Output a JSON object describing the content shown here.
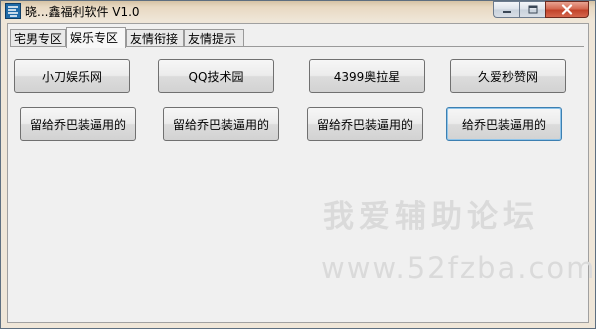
{
  "window": {
    "title": "晓...鑫福利软件  V1.0"
  },
  "tabs": [
    {
      "label": "宅男专区"
    },
    {
      "label": "娱乐专区"
    },
    {
      "label": "友情衔接"
    },
    {
      "label": "友情提示"
    }
  ],
  "buttons_row1": [
    {
      "label": "小刀娱乐网"
    },
    {
      "label": "QQ技术园"
    },
    {
      "label": "4399奥拉星"
    },
    {
      "label": "久爱秒赞网"
    }
  ],
  "buttons_row2": [
    {
      "label": "留给乔巴装逼用的"
    },
    {
      "label": "留给乔巴装逼用的"
    },
    {
      "label": "留给乔巴装逼用的"
    },
    {
      "label": "给乔巴装逼用的"
    }
  ],
  "watermark": {
    "site_name": "我爱辅助论坛",
    "url": "www.52fzba.com"
  },
  "colors": {
    "close_button": "#c2432a",
    "focus_border": "#3c7fb1"
  }
}
